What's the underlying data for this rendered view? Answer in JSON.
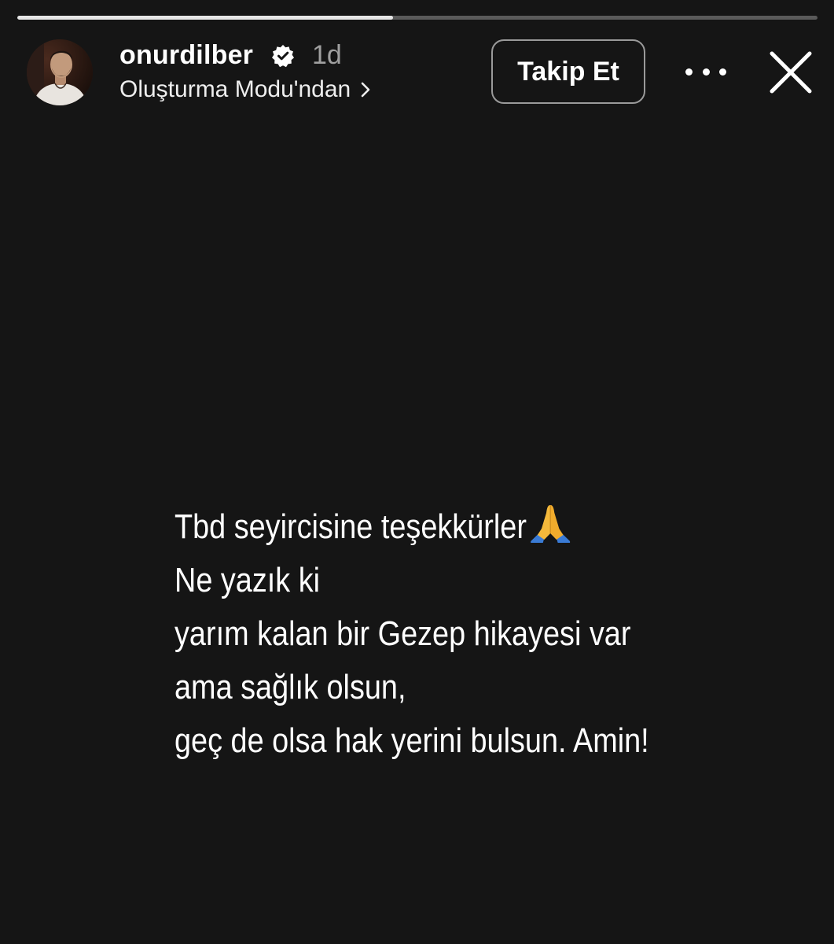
{
  "progress": {
    "fraction": 0.47
  },
  "header": {
    "username": "onurdilber",
    "verified": true,
    "time_ago": "1d",
    "subtitle": "Oluşturma Modu'ndan",
    "follow_label": "Takip Et"
  },
  "icons": {
    "verified": "verified-badge-icon",
    "chevron": "chevron-right-icon",
    "more": "more-dots-icon",
    "close": "close-icon",
    "emoji": "folded-hands-emoji"
  },
  "story": {
    "lines": [
      "Tbd seyircisine teşekkürler",
      "Ne yazık ki",
      "yarım kalan bir Gezep hikayesi var",
      "ama sağlık olsun,",
      "geç de olsa hak yerini bulsun. Amin!"
    ],
    "emoji": "🙏"
  },
  "colors": {
    "background": "#151515",
    "progress_track": "#5a5a5a",
    "progress_fill": "#e6e6e6",
    "verified_badge": "#ffffff",
    "text": "#ffffff"
  }
}
